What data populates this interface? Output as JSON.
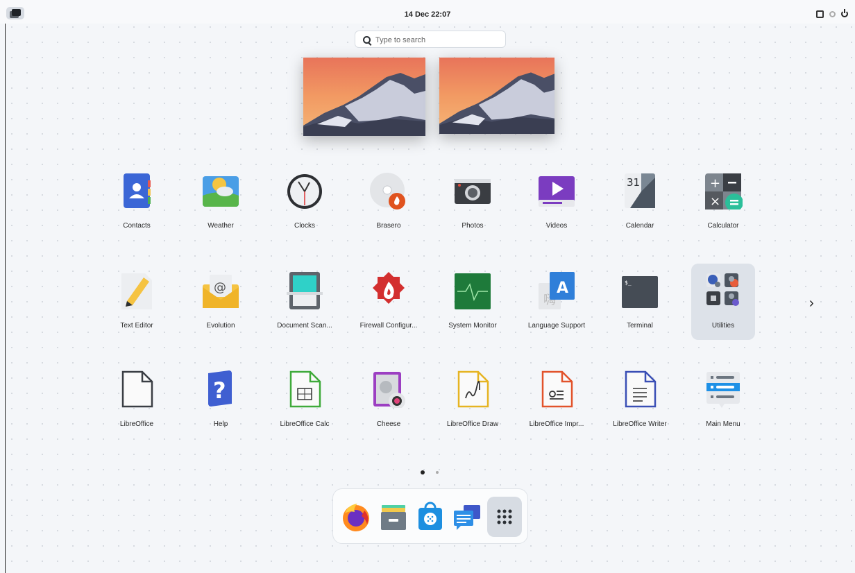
{
  "topbar": {
    "datetime": "14 Dec  22:07"
  },
  "search": {
    "placeholder": "Type to search"
  },
  "workspaces": [
    {
      "name": "workspace-1"
    },
    {
      "name": "workspace-2"
    }
  ],
  "apps": [
    {
      "label": "Contacts",
      "icon": "contacts-icon"
    },
    {
      "label": "Weather",
      "icon": "weather-icon"
    },
    {
      "label": "Clocks",
      "icon": "clocks-icon"
    },
    {
      "label": "Brasero",
      "icon": "brasero-icon"
    },
    {
      "label": "Photos",
      "icon": "photos-icon"
    },
    {
      "label": "Videos",
      "icon": "videos-icon"
    },
    {
      "label": "Calendar",
      "icon": "calendar-icon",
      "day": "31"
    },
    {
      "label": "Calculator",
      "icon": "calculator-icon"
    },
    {
      "label": "Text Editor",
      "icon": "text-editor-icon"
    },
    {
      "label": "Evolution",
      "icon": "evolution-icon"
    },
    {
      "label": "Document Scan...",
      "icon": "document-scanner-icon"
    },
    {
      "label": "Firewall Configur...",
      "icon": "firewall-icon"
    },
    {
      "label": "System Monitor",
      "icon": "system-monitor-icon"
    },
    {
      "label": "Language Support",
      "icon": "language-support-icon",
      "glyph": "A"
    },
    {
      "label": "Terminal",
      "icon": "terminal-icon",
      "prompt": "$_"
    },
    {
      "label": "Utilities",
      "icon": "utilities-folder-icon"
    },
    {
      "label": "LibreOffice",
      "icon": "libreoffice-icon"
    },
    {
      "label": "Help",
      "icon": "help-icon",
      "glyph": "?"
    },
    {
      "label": "LibreOffice Calc",
      "icon": "libreoffice-calc-icon"
    },
    {
      "label": "Cheese",
      "icon": "cheese-icon"
    },
    {
      "label": "LibreOffice Draw",
      "icon": "libreoffice-draw-icon"
    },
    {
      "label": "LibreOffice Impr...",
      "icon": "libreoffice-impress-icon"
    },
    {
      "label": "LibreOffice Writer",
      "icon": "libreoffice-writer-icon"
    },
    {
      "label": "Main Menu",
      "icon": "main-menu-icon"
    }
  ],
  "pagination": {
    "pages": 2,
    "current": 1
  },
  "next_page": {
    "icon": "chevron-right-icon",
    "glyph": "›"
  },
  "dock": [
    {
      "name": "firefox",
      "icon": "firefox-icon"
    },
    {
      "name": "files",
      "icon": "files-icon"
    },
    {
      "name": "software",
      "icon": "software-icon"
    },
    {
      "name": "messages",
      "icon": "chat-icon"
    },
    {
      "name": "show-apps",
      "icon": "app-grid-icon"
    }
  ],
  "colors": {
    "background": "#f4f6f9",
    "selected_tile": "#dde2e9",
    "dock_bg": "#fbfcfd"
  }
}
